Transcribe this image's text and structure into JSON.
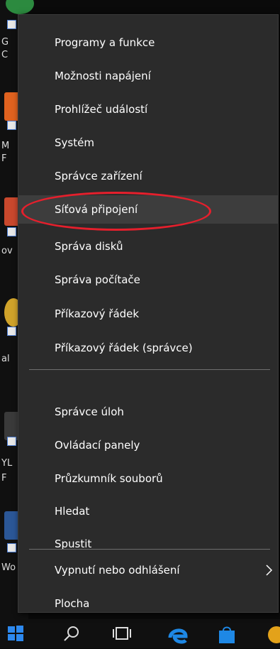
{
  "menu": {
    "items": [
      {
        "label": "Programy a funkce"
      },
      {
        "label": "Možnosti napájení"
      },
      {
        "label": "Prohlížeč událostí"
      },
      {
        "label": "Systém"
      },
      {
        "label": "Správce zařízení"
      },
      {
        "label": "Síťová připojení"
      },
      {
        "label": "Správa disků"
      },
      {
        "label": "Správa počítače"
      },
      {
        "label": "Příkazový řádek"
      },
      {
        "label": "Příkazový řádek (správce)"
      },
      {
        "label": "Správce úloh"
      },
      {
        "label": "Ovládací panely"
      },
      {
        "label": "Průzkumník souborů"
      },
      {
        "label": "Hledat"
      },
      {
        "label": "Spustit"
      },
      {
        "label": "Vypnutí nebo odhlášení"
      },
      {
        "label": "Plocha"
      }
    ],
    "highlighted_item": "Síťová připojení",
    "annotation_color": "#e51f2c"
  },
  "desktop": {
    "edge_text": [
      "G",
      "C",
      "M",
      "F",
      "ov",
      "al",
      "YL",
      "F",
      "Wo"
    ]
  },
  "taskbar": {
    "icons": [
      "windows-start-icon",
      "search-icon",
      "task-view-icon",
      "edge-browser-icon",
      "store-icon",
      "app-icon"
    ]
  }
}
